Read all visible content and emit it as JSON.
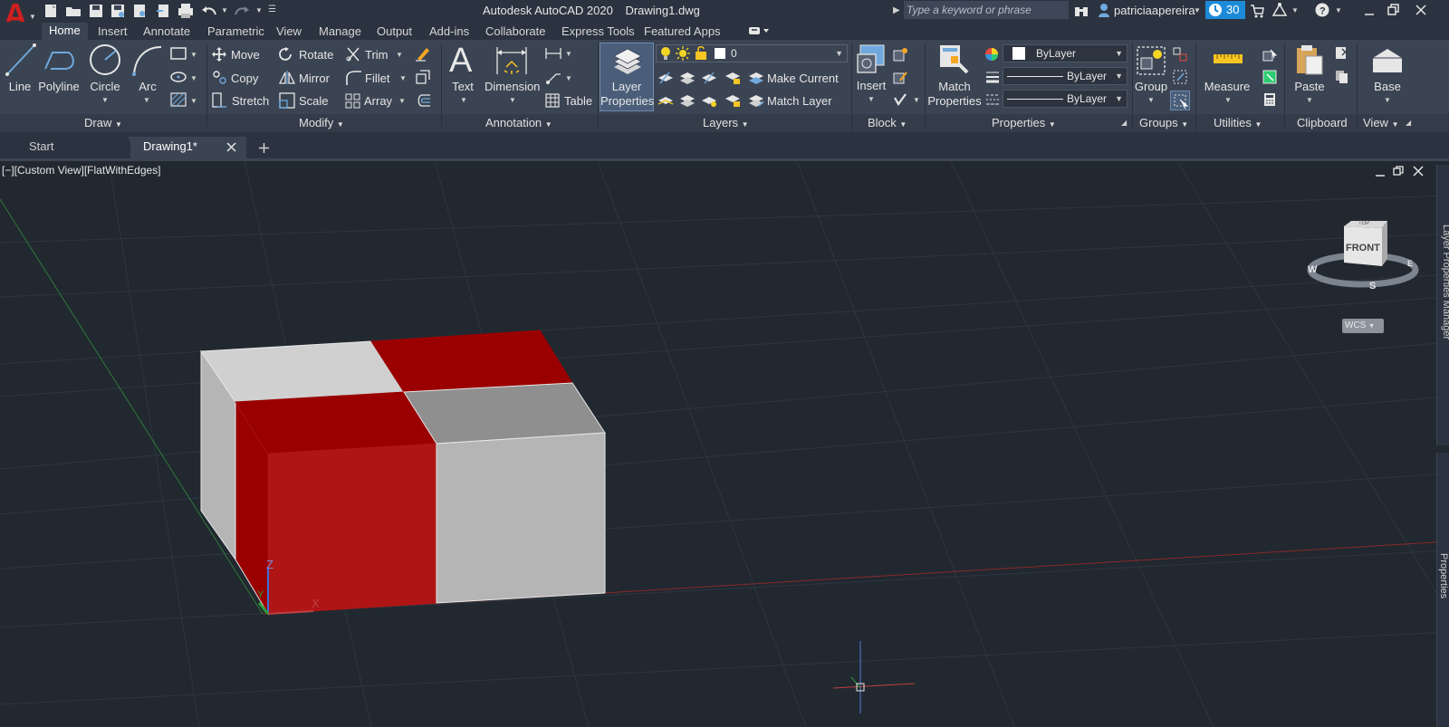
{
  "app": {
    "title": "Autodesk AutoCAD 2020",
    "document": "Drawing1.dwg",
    "logo_letter": "A"
  },
  "search": {
    "placeholder": "Type a keyword or phrase"
  },
  "user": {
    "name": "patriciaapereira",
    "trial_days": "30"
  },
  "ribbon_tabs": [
    "Home",
    "Insert",
    "Annotate",
    "Parametric",
    "View",
    "Manage",
    "Output",
    "Add-ins",
    "Collaborate",
    "Express Tools",
    "Featured Apps"
  ],
  "draw": {
    "title": "Draw",
    "line": "Line",
    "polyline": "Polyline",
    "circle": "Circle",
    "arc": "Arc"
  },
  "modify": {
    "title": "Modify",
    "move": "Move",
    "rotate": "Rotate",
    "trim": "Trim",
    "copy": "Copy",
    "mirror": "Mirror",
    "fillet": "Fillet",
    "stretch": "Stretch",
    "scale": "Scale",
    "array": "Array"
  },
  "annotation": {
    "title": "Annotation",
    "text": "Text",
    "dimension": "Dimension",
    "table": "Table"
  },
  "layers": {
    "title": "Layers",
    "layer_properties_1": "Layer",
    "layer_properties_2": "Properties",
    "current_layer": "0",
    "make_current": "Make Current",
    "match_layer": "Match Layer"
  },
  "block": {
    "title": "Block",
    "insert": "Insert"
  },
  "properties": {
    "title": "Properties",
    "match_1": "Match",
    "match_2": "Properties",
    "color": "ByLayer",
    "linetype": "ByLayer",
    "lineweight": "ByLayer"
  },
  "groups": {
    "title": "Groups",
    "group": "Group"
  },
  "utilities": {
    "title": "Utilities",
    "measure": "Measure"
  },
  "clipboard": {
    "title": "Clipboard",
    "paste": "Paste"
  },
  "view": {
    "title": "View",
    "base": "Base"
  },
  "doc_tabs": {
    "start": "Start",
    "drawing": "Drawing1*"
  },
  "viewport": {
    "label": "[−][Custom View][FlatWithEdges]",
    "viewcube_face": "FRONT",
    "viewcube_top": "TOP",
    "compass_w": "W",
    "compass_s": "S",
    "compass_e": "E",
    "wcs": "WCS",
    "side_palette_1": "Layer Properties Manager",
    "side_palette_2": "Properties"
  },
  "ucs": {
    "z": "Z",
    "y": "Y",
    "x": "X"
  },
  "colors": {
    "accent_blue": "#1c8ad8",
    "face_red": "#b01515",
    "face_dark_red": "#9a0000",
    "face_light": "#b5b5b5",
    "face_top_light": "#d0d0d0",
    "face_top_mid": "#8f8f8f"
  }
}
